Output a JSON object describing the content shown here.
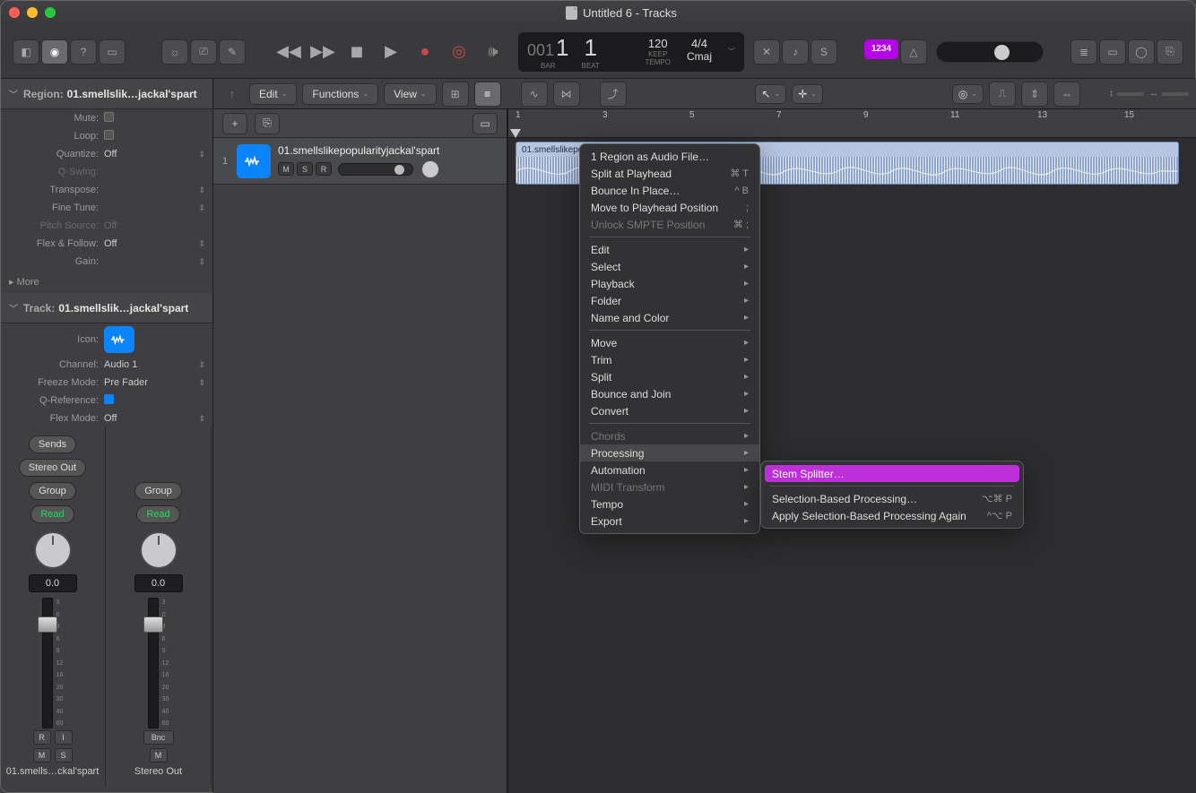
{
  "window": {
    "title": "Untitled 6 - Tracks"
  },
  "lcd": {
    "pos_big1": "001",
    "pos_big2": "1",
    "pos_big3": "1",
    "label_bar": "BAR",
    "label_beat": "BEAT",
    "tempo": "120",
    "tempo_keep": "KEEP",
    "tempo_label": "TEMPO",
    "sig": "4/4",
    "key": "Cmaj"
  },
  "badge_1234": "1234",
  "inspector": {
    "region_label": "Region:",
    "region_name": "01.smellslik…jackal'spart",
    "mute": "Mute:",
    "loop": "Loop:",
    "quantize": "Quantize:",
    "quantize_val": "Off",
    "qswing": "Q-Swing:",
    "transpose": "Transpose:",
    "finetune": "Fine Tune:",
    "pitchsource": "Pitch Source:",
    "pitchsource_val": "Off",
    "flexfollow": "Flex & Follow:",
    "flexfollow_val": "Off",
    "gain": "Gain:",
    "more": "More",
    "track_label": "Track:",
    "track_name": "01.smellslik…jackal'spart",
    "icon_label": "Icon:",
    "channel": "Channel:",
    "channel_val": "Audio 1",
    "freeze": "Freeze Mode:",
    "freeze_val": "Pre Fader",
    "qref": "Q-Reference:",
    "flexmode": "Flex Mode:",
    "flexmode_val": "Off"
  },
  "mixer": {
    "sends": "Sends",
    "stereo_out": "Stereo Out",
    "group": "Group",
    "read": "Read",
    "db": "0.0",
    "ch1_name": "01.smells…ckal'spart",
    "ch2_name": "Stereo Out",
    "ri_r": "R",
    "ri_i": "I",
    "bnc": "Bnc",
    "m": "M",
    "s": "S",
    "ticks": [
      "3",
      "0",
      "3",
      "6",
      "9",
      "12",
      "16",
      "20",
      "30",
      "40",
      "60"
    ]
  },
  "arr": {
    "edit": "Edit",
    "functions": "Functions",
    "view": "View",
    "track_num": "1",
    "track_name": "01.smellslikepopularityjackal'spart",
    "m": "M",
    "s": "S",
    "r": "R"
  },
  "timeline": {
    "bars": [
      "1",
      "3",
      "5",
      "7",
      "9",
      "11",
      "13",
      "15"
    ],
    "region_name": "01.smellslikepopularityjackal'spart"
  },
  "ctx": {
    "items1": [
      {
        "label": "1 Region as Audio File…",
        "sc": ""
      },
      {
        "label": "Split at Playhead",
        "sc": "⌘ T"
      },
      {
        "label": "Bounce In Place…",
        "sc": "^ B"
      },
      {
        "label": "Move to Playhead Position",
        "sc": ";"
      },
      {
        "label": "Unlock SMPTE Position",
        "sc": "⌘ ;",
        "dis": true
      }
    ],
    "items2": [
      {
        "label": "Edit",
        "sub": true
      },
      {
        "label": "Select",
        "sub": true
      },
      {
        "label": "Playback",
        "sub": true
      },
      {
        "label": "Folder",
        "sub": true
      },
      {
        "label": "Name and Color",
        "sub": true
      }
    ],
    "items3": [
      {
        "label": "Move",
        "sub": true
      },
      {
        "label": "Trim",
        "sub": true
      },
      {
        "label": "Split",
        "sub": true
      },
      {
        "label": "Bounce and Join",
        "sub": true
      },
      {
        "label": "Convert",
        "sub": true
      }
    ],
    "items4": [
      {
        "label": "Chords",
        "sub": true,
        "dis": true
      },
      {
        "label": "Processing",
        "sub": true,
        "hover": true
      },
      {
        "label": "Automation",
        "sub": true
      },
      {
        "label": "MIDI Transform",
        "sub": true,
        "dis": true
      },
      {
        "label": "Tempo",
        "sub": true
      },
      {
        "label": "Export",
        "sub": true
      }
    ]
  },
  "submenu": {
    "items": [
      {
        "label": "Stem Splitter…",
        "hl": true
      },
      {
        "label": "Selection-Based Processing…",
        "sc": "⌥⌘ P"
      },
      {
        "label": "Apply Selection-Based Processing Again",
        "sc": "^⌥ P"
      }
    ]
  }
}
